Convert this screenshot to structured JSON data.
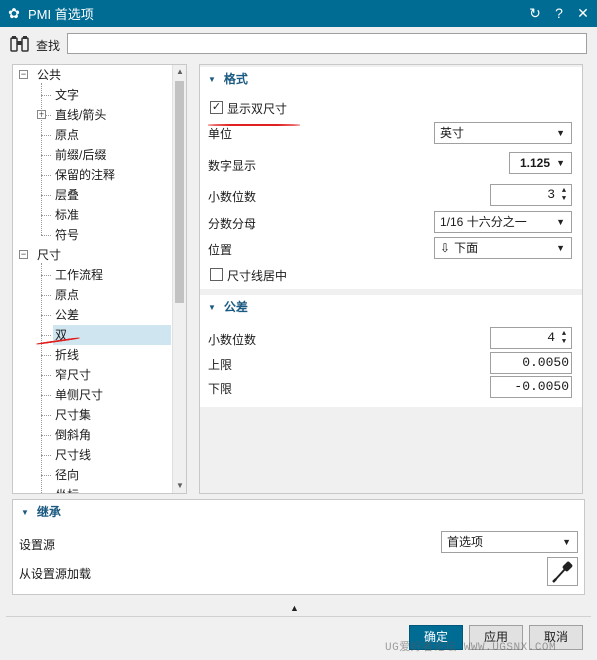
{
  "window": {
    "title": "PMI 首选项"
  },
  "search": {
    "label": "查找",
    "value": ""
  },
  "tree": {
    "items": [
      {
        "label": "公共"
      },
      {
        "label": "文字"
      },
      {
        "label": "直线/箭头"
      },
      {
        "label": "原点"
      },
      {
        "label": "前缀/后缀"
      },
      {
        "label": "保留的注释"
      },
      {
        "label": "层叠"
      },
      {
        "label": "标准"
      },
      {
        "label": "符号"
      },
      {
        "label": "尺寸"
      },
      {
        "label": "工作流程"
      },
      {
        "label": "原点"
      },
      {
        "label": "公差"
      },
      {
        "label": "双"
      },
      {
        "label": "折线"
      },
      {
        "label": "窄尺寸"
      },
      {
        "label": "单侧尺寸"
      },
      {
        "label": "尺寸集"
      },
      {
        "label": "倒斜角"
      },
      {
        "label": "尺寸线"
      },
      {
        "label": "径向"
      },
      {
        "label": "坐标"
      }
    ]
  },
  "format_group": {
    "title": "格式",
    "show_dual": {
      "label": "显示双尺寸",
      "checked": true,
      "mark": "✓"
    },
    "unit": {
      "label": "单位",
      "value": "英寸"
    },
    "numeric_display": {
      "label": "数字显示",
      "value": "1.125"
    },
    "decimals": {
      "label": "小数位数",
      "value": "3"
    },
    "fraction_denominator": {
      "label": "分数分母",
      "value": "1/16 十六分之一"
    },
    "position": {
      "label": "位置",
      "value": "下面",
      "icon": "arrow-down-icon"
    },
    "center_dim_line": {
      "label": "尺寸线居中",
      "checked": false
    }
  },
  "tolerance_group": {
    "title": "公差",
    "decimals": {
      "label": "小数位数",
      "value": "4"
    },
    "upper": {
      "label": "上限",
      "value": "0.0050"
    },
    "lower": {
      "label": "下限",
      "value": "-0.0050"
    }
  },
  "inherit_group": {
    "title": "继承",
    "source": {
      "label": "设置源",
      "value": "首选项"
    },
    "load_from_source": {
      "label": "从设置源加载",
      "icon": "eyedropper-icon"
    }
  },
  "buttons": {
    "ok": "确定",
    "apply": "应用",
    "cancel": "取消"
  },
  "watermark": "UG爱好者论坛 WWW.UGSNX.COM",
  "colors": {
    "accent": "#006c94",
    "group_title": "#1a5a80",
    "selection": "#cfe6f0",
    "annotation_red": "#e02020"
  }
}
